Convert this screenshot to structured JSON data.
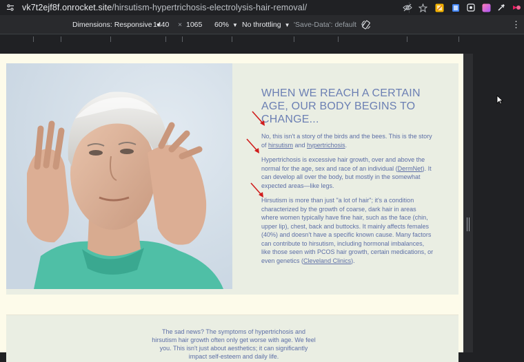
{
  "browser": {
    "url_host": "vk7t2ejf8f.onrocket.site",
    "url_path": "/hirsutism-hypertrichosis-electrolysis-hair-removal/",
    "icons": [
      "site-info-icon",
      "eye-off-icon",
      "star-icon",
      "extension-icon",
      "extension-icon",
      "extension-icon",
      "extension-icon",
      "eyedropper-icon",
      "extension-icon"
    ]
  },
  "devtools": {
    "dimensions_label": "Dimensions: Responsive",
    "width": "1440",
    "times": "×",
    "height": "1065",
    "zoom": "60%",
    "throttling": "No throttling",
    "save_data": "'Save-Data': default",
    "more": "⋮"
  },
  "hero": {
    "headline": "When we reach a certain age, our body begins to change...",
    "p1_a": "No, this isn't a story of the birds and the bees. This is the story of ",
    "p1_link1": "hirsutism",
    "p1_mid": " and ",
    "p1_link2": "hypertrichosis",
    "p1_end": ".",
    "p2_a": "Hypertrichosis is excessive hair growth, over and above the normal for the age, sex and race of an individual (",
    "p2_link": "DermNet",
    "p2_b": "). It can develop all over the body, but mostly in the somewhat expected areas—like legs.",
    "p3_a": "Hirsutism is more than just \"a lot of hair\"; it's a condition characterized by the growth of coarse, dark hair in areas where women typically have fine hair, such as the face (chin, upper lip), chest, back and buttocks. It mainly affects females (40%) and doesn't have a specific known cause. Many factors can contribute to hirsutism, including hormonal imbalances, like those seen with PCOS hair growth, certain medications, or even genetics (",
    "p3_link": "Cleveland Clinics",
    "p3_b": ")."
  },
  "lower": {
    "text": "The sad news? The symptoms of hypertrichosis and hirsutism hair growth often only get worse with age. We feel you. This isn't just about aesthetics; it can significantly impact self-esteem and daily life."
  },
  "colors": {
    "accent_text": "#5c6ea6",
    "page_bg": "#fdfbea",
    "annotation_arrow": "#d01c1c"
  }
}
